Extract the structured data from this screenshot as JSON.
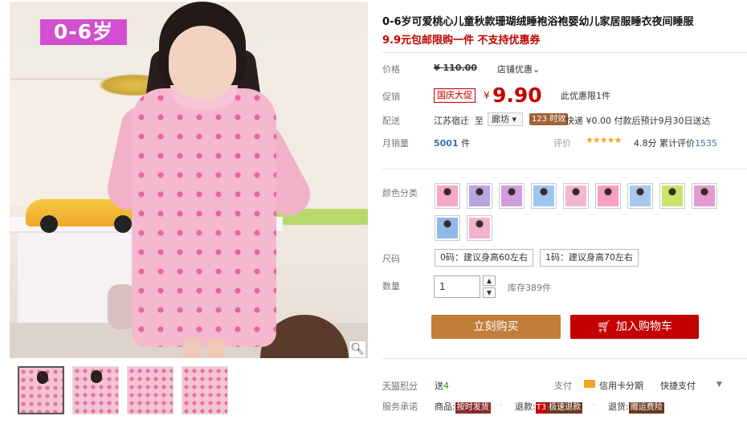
{
  "gallery": {
    "age_badge": "0-6岁",
    "zoom_icon": "magnifier-icon",
    "thumbnail_count": 4
  },
  "product": {
    "title": "0-6岁可爱桃心儿童秋款珊瑚绒睡袍浴袍婴幼儿家居服睡衣夜间睡服",
    "subtitle": "9.9元包邮限购一件 不支持优惠券"
  },
  "price": {
    "label": "价格",
    "original": "¥ 110.00",
    "store_promo": "店铺优惠⌄"
  },
  "promo": {
    "label": "促销",
    "tag": "国庆大促",
    "yen": "¥",
    "price": "9.90",
    "limit": "此优惠限1件"
  },
  "shipping": {
    "label": "配送",
    "from": "江苏宿迁",
    "to": "至",
    "city": "廊坊 ▾",
    "timed": "123 时效",
    "info": "快递 ¥0.00 付款后预计9月30日送达"
  },
  "sales": {
    "label": "月销量",
    "count": "5001",
    "unit": "件",
    "rating_label": "评价",
    "stars": "★★★★★",
    "score": "4.8分",
    "reviews_prefix": "累计评价",
    "reviews_count": "1535"
  },
  "colors": {
    "label": "颜色分类",
    "swatches": [
      "#f3a9c7",
      "#b6a6e2",
      "#d39be0",
      "#9fc5ef",
      "#f4b7d1",
      "#f7a0c4",
      "#a8c8ee",
      "#c8e36a",
      "#e39bd0",
      "#8fb9ea",
      "#f3b2cd"
    ]
  },
  "sizes": {
    "label": "尺码",
    "options": [
      "0码：建议身高60左右",
      "1码：建议身高70左右"
    ]
  },
  "quantity": {
    "label": "数量",
    "value": "1",
    "stock": "库存389件"
  },
  "buttons": {
    "buy_now": "立刻购买",
    "add_cart": "加入购物车"
  },
  "footer": {
    "points_label": "天猫积分",
    "points_prefix": "送",
    "points_value": "4",
    "pay_label": "支付",
    "pay_card": "信用卡分期",
    "pay_quick": "快捷支付",
    "service_label": "服务承诺",
    "service_goods": "商品:",
    "service_goods_tag": "按时发货",
    "service_refund": "退款:",
    "service_refund_t3": "T3",
    "service_refund_tag": "极速退款",
    "service_return": "退货:",
    "service_return_tag": "赠运费险"
  },
  "colors_theme": {
    "accent_red": "#c40000",
    "buy_orange": "#c17e3a",
    "badge_purple": "#d24fcf"
  }
}
